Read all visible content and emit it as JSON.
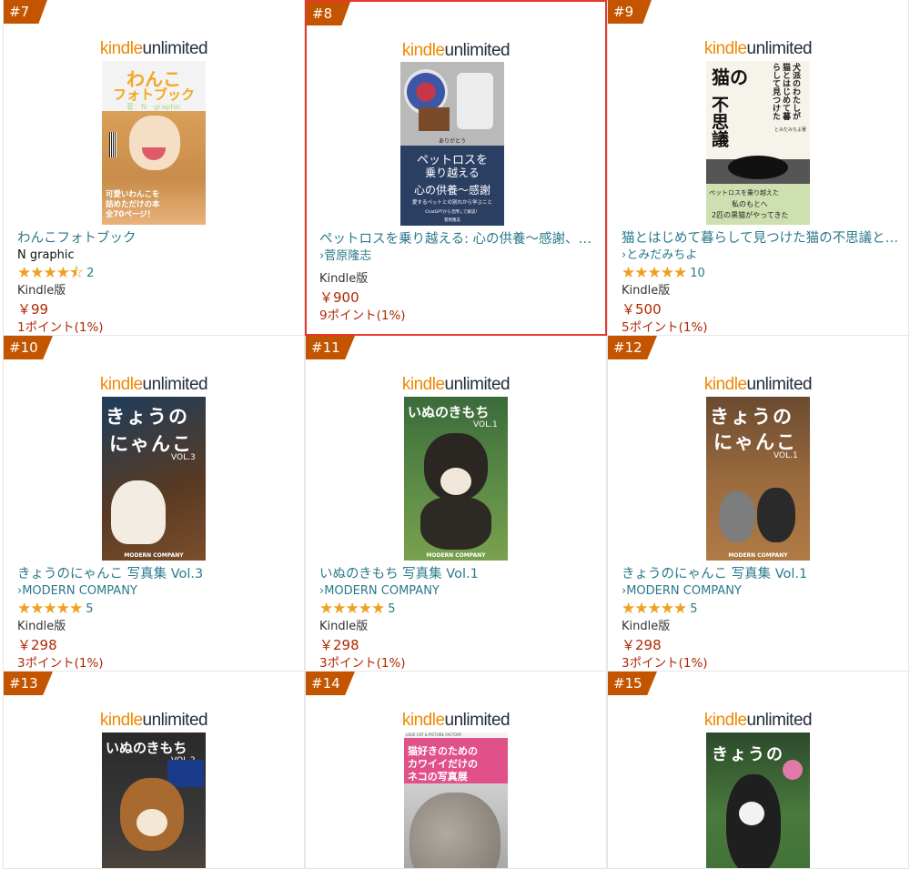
{
  "ku_logo": {
    "kindle": "kindle",
    "unlimited": "unlimited"
  },
  "items": [
    {
      "rank": "#7",
      "title": "わんこフォトブック",
      "author": "N graphic",
      "stars": "★★★★⯪",
      "rating_count": "2",
      "format": "Kindle版",
      "price": "￥99",
      "points": "1ポイント(1%)",
      "cover": {
        "t1": "わんこ",
        "t2": "フォトブック",
        "t3": "著：N　graphic",
        "t4": "可愛いわんこを",
        "t5": "詰めただけの本",
        "t6": "全70ページ！"
      }
    },
    {
      "rank": "#8",
      "title": "ペットロスを乗り越える: 心の供養〜感謝、…",
      "author": "›菅原隆志",
      "format": "Kindle版",
      "price": "￥900",
      "points": "9ポイント(1%)",
      "cover": {
        "t0": "ありがとう",
        "t1": "ペットロスを",
        "t2": "乗り越える",
        "t3": "心の供養〜感謝",
        "t4": "愛するペットとの別れから学ぶこと",
        "t5": "ChatGPTから活用して解説！",
        "t6": "菅原隆志"
      }
    },
    {
      "rank": "#9",
      "title": "猫とはじめて暮らして見つけた猫の不思議と…",
      "author": "›とみだみちよ",
      "stars": "★★★★★",
      "rating_count": "10",
      "format": "Kindle版",
      "price": "￥500",
      "points": "5ポイント(1%)",
      "cover": {
        "t1": "猫の",
        "t2": "不思議",
        "t3": "と",
        "t4": "魅力",
        "t5": "犬派のわたしが猫とはじめて暮らして見つけた",
        "t6": "とみだみちよ著",
        "t7": "ペットロスを乗り越えた",
        "t8": "私のもとへ",
        "t9": "2匹の黒猫がやってきた"
      }
    },
    {
      "rank": "#10",
      "title": "きょうのにゃんこ 写真集 Vol.3",
      "author": "›MODERN COMPANY",
      "stars": "★★★★★",
      "rating_count": "5",
      "format": "Kindle版",
      "price": "￥298",
      "points": "3ポイント(1%)",
      "cover": {
        "t1": "きょうの",
        "t2": "にゃんこ",
        "t3": "VOL.3",
        "t4": "MODERN COMPANY"
      }
    },
    {
      "rank": "#11",
      "title": "いぬのきもち 写真集 Vol.1",
      "author": "›MODERN COMPANY",
      "stars": "★★★★★",
      "rating_count": "5",
      "format": "Kindle版",
      "price": "￥298",
      "points": "3ポイント(1%)",
      "cover": {
        "t1": "いぬのきもち",
        "t3": "VOL.1",
        "t4": "MODERN COMPANY"
      }
    },
    {
      "rank": "#12",
      "title": "きょうのにゃんこ 写真集 Vol.1",
      "author": "›MODERN COMPANY",
      "stars": "★★★★★",
      "rating_count": "5",
      "format": "Kindle版",
      "price": "￥298",
      "points": "3ポイント(1%)",
      "cover": {
        "t1": "きょうの",
        "t2": "にゃんこ",
        "t3": "VOL.1",
        "t4": "MODERN COMPANY"
      }
    },
    {
      "rank": "#13",
      "cover": {
        "t1": "いぬのきもち",
        "t3": "VOL.2"
      }
    },
    {
      "rank": "#14",
      "cover": {
        "t0": "LOVE CAT & PICTURE FACTORY",
        "t1": "猫好きのための",
        "t2": "カワイイだけの",
        "t3": "ネコの写真展"
      }
    },
    {
      "rank": "#15",
      "cover": {
        "t1": "きょうの"
      }
    }
  ]
}
